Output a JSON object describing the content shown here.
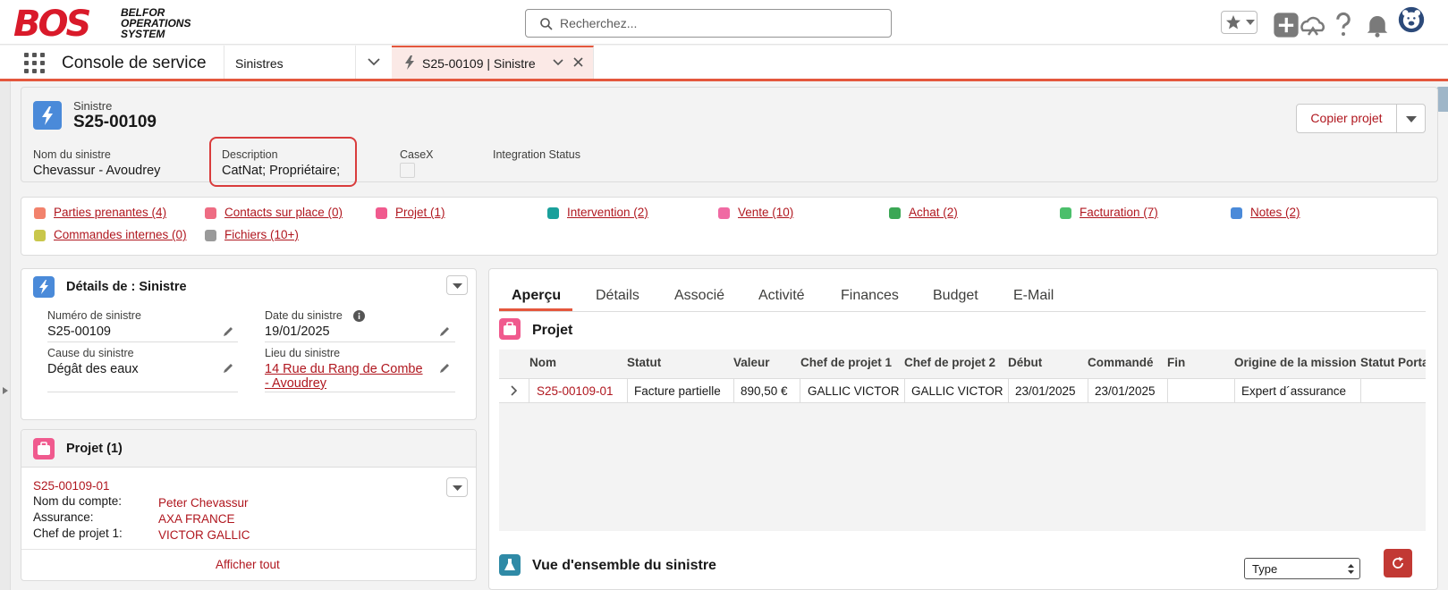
{
  "brand": {
    "logo_big": "BOS",
    "logo_line1": "BELFOR",
    "logo_line2": "OPERATIONS",
    "logo_line3": "SYSTEM",
    "accent": "#e4573d",
    "link_color": "#b0171f"
  },
  "search": {
    "placeholder": "Recherchez..."
  },
  "header_icons": [
    "star-icon",
    "add-icon",
    "cloud-icon",
    "help-icon",
    "bell-icon",
    "avatar"
  ],
  "nav": {
    "app_name": "Console de service",
    "object_tab": "Sinistres",
    "record_tab": "S25-00109 | Sinistre"
  },
  "record": {
    "type_label": "Sinistre",
    "title": "S25-00109",
    "copy_button": "Copier projet",
    "fields": [
      {
        "label": "Nom du sinistre",
        "value": "Chevassur - Avoudrey"
      },
      {
        "label": "Description",
        "value": "CatNat; Propriétaire;"
      },
      {
        "label": "CaseX",
        "value": ""
      },
      {
        "label": "Integration Status",
        "value": ""
      }
    ]
  },
  "quicklinks": [
    {
      "label": "Parties prenantes (4)",
      "color": "#f2826c"
    },
    {
      "label": "Contacts sur place (0)",
      "color": "#ee6c83"
    },
    {
      "label": "Projet (1)",
      "color": "#f05a8e"
    },
    {
      "label": "Intervention (2)",
      "color": "#1aa09b"
    },
    {
      "label": "Vente (10)",
      "color": "#f06aa3"
    },
    {
      "label": "Achat (2)",
      "color": "#3ba755"
    },
    {
      "label": "Facturation (7)",
      "color": "#4bbf6b"
    },
    {
      "label": "Notes (2)",
      "color": "#4a8ad9"
    },
    {
      "label": "Commandes internes (0)",
      "color": "#c9c74b"
    },
    {
      "label": "Fichiers (10+)",
      "color": "#9a9a9a"
    }
  ],
  "details": {
    "title": "Détails de : Sinistre",
    "fields": [
      {
        "label": "Numéro de sinistre",
        "value": "S25-00109"
      },
      {
        "label": "Date du sinistre",
        "value": "19/01/2025"
      },
      {
        "label": "Cause du sinistre",
        "value": "Dégât des eaux"
      },
      {
        "label": "Lieu du sinistre",
        "value_line1": "14 Rue du Rang de Combe",
        "value_line2": "- Avoudrey"
      }
    ]
  },
  "projet_card": {
    "title": "Projet (1)",
    "record": "S25-00109-01",
    "rows": [
      {
        "label": "Nom du compte:",
        "value": "Peter Chevassur"
      },
      {
        "label": "Assurance:",
        "value": "AXA FRANCE"
      },
      {
        "label": "Chef de projet 1:",
        "value": "VICTOR GALLIC"
      }
    ],
    "view_all": "Afficher tout"
  },
  "tabs": [
    "Aperçu",
    "Détails",
    "Associé",
    "Activité",
    "Finances",
    "Budget",
    "E-Mail"
  ],
  "projet_section": {
    "title": "Projet",
    "columns": [
      "Nom",
      "Statut",
      "Valeur",
      "Chef de projet 1",
      "Chef de projet 2",
      "Début",
      "Commandé",
      "Fin",
      "Origine de la mission",
      "Statut Porta"
    ],
    "row": [
      "S25-00109-01",
      "Facture partielle",
      "890,50 €",
      "GALLIC VICTOR",
      "GALLIC VICTOR",
      "23/01/2025",
      "23/01/2025",
      "",
      "Expert d´assurance",
      ""
    ]
  },
  "vue": {
    "title": "Vue d'ensemble du sinistre",
    "type_select": "Type"
  }
}
